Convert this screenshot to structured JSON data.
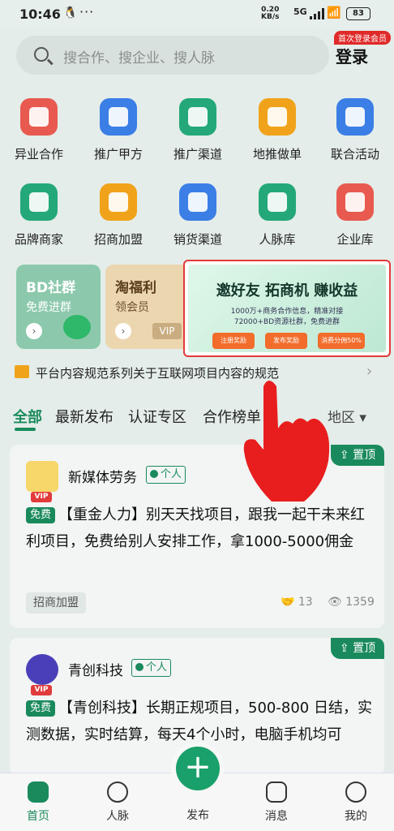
{
  "status": {
    "time": "10:46",
    "dots": "···",
    "net_top": "0.20",
    "net_bottom": "KB/s",
    "signal": "5G",
    "battery": "83"
  },
  "header": {
    "search_placeholder": "搜合作、搜企业、搜人脉",
    "login": "登录",
    "login_badge": "首次登录会员"
  },
  "grid": [
    {
      "label": "异业合作",
      "color": "#e85a4f",
      "icon": "briefcase-icon"
    },
    {
      "label": "推广甲方",
      "color": "#3b7ee6",
      "icon": "presentation-icon"
    },
    {
      "label": "推广渠道",
      "color": "#24a879",
      "icon": "droplet-icon"
    },
    {
      "label": "地推做单",
      "color": "#f0a31a",
      "icon": "folder-icon"
    },
    {
      "label": "联合活动",
      "color": "#3b7ee6",
      "icon": "gift-icon"
    },
    {
      "label": "品牌商家",
      "color": "#24a879",
      "icon": "star-icon"
    },
    {
      "label": "招商加盟",
      "color": "#f0a31a",
      "icon": "trophy-icon"
    },
    {
      "label": "销货渠道",
      "color": "#3b7ee6",
      "icon": "shopping-icon"
    },
    {
      "label": "人脉库",
      "color": "#24a879",
      "icon": "person-tie-icon"
    },
    {
      "label": "企业库",
      "color": "#e85a4f",
      "icon": "document-icon"
    }
  ],
  "cards": [
    {
      "title": "BD社群",
      "subtitle": "免费进群",
      "color": "#7cc3a2"
    },
    {
      "title": "淘福利",
      "subtitle": "领会员",
      "color": "#e8c58f",
      "tag": "VIP"
    }
  ],
  "promo": {
    "title": "邀好友 拓商机 赚收益",
    "line1": "1000万+商务合作信息，精准对接",
    "line2": "72000+BD资源社群，免费进群",
    "btn1": "注册奖励",
    "btn2": "发布奖励",
    "btn3": "消费分佣50%"
  },
  "notice": {
    "text": "平台内容规范系列关于互联网项目内容的规范"
  },
  "tabs": {
    "items": [
      "全部",
      "最新发布",
      "认证专区",
      "合作榜单"
    ],
    "region": "地区 ▾"
  },
  "posts": [
    {
      "name": "新媒体劳务",
      "tag": "个人",
      "vip": "VIP",
      "pin": "置顶",
      "free": "免费",
      "body": "【重金人力】别天天找项目，跟我一起干未来红利项目，免费给别人安排工作，拿1000-5000佣金",
      "category": "招商加盟",
      "likes": "13",
      "views": "1359"
    },
    {
      "name": "青创科技",
      "tag": "个人",
      "vip": "VIP",
      "pin": "置顶",
      "free": "免费",
      "body": "【青创科技】长期正规项目，500-800 日结，实测数据，实时结算，每天4个小时，电脑手机均可"
    }
  ],
  "nav": {
    "home": "首页",
    "contacts": "人脉",
    "publish": "发布",
    "messages": "消息",
    "mine": "我的"
  }
}
